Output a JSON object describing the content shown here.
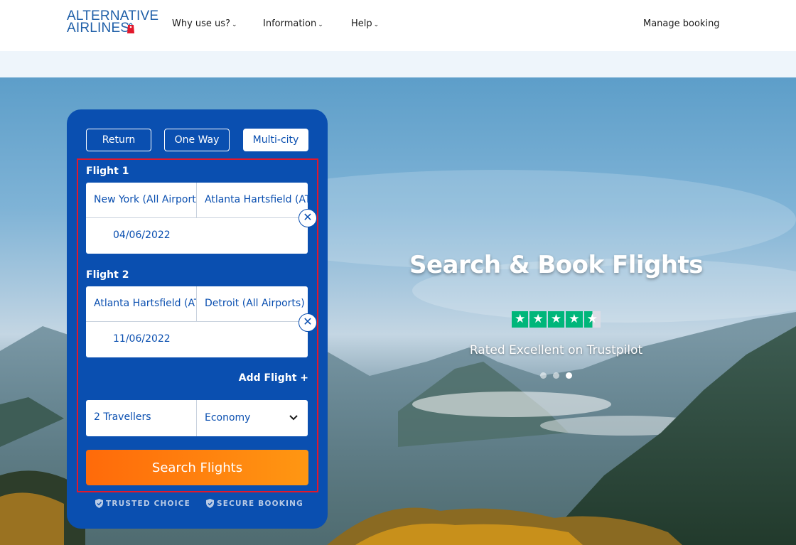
{
  "header": {
    "logo_line1": "ALTERNATIVE",
    "logo_line2": "AIRLINES",
    "nav": [
      {
        "label": "Why use us?"
      },
      {
        "label": "Information"
      },
      {
        "label": "Help"
      }
    ],
    "manage_booking": "Manage booking"
  },
  "hero": {
    "title": "Search & Book Flights",
    "rating_text": "Rated Excellent on Trustpilot",
    "stars": 4.5,
    "carousel_active_index": 2,
    "carousel_count": 3
  },
  "search": {
    "trip_types": [
      {
        "label": "Return",
        "active": false
      },
      {
        "label": "One Way",
        "active": false
      },
      {
        "label": "Multi-city",
        "active": true
      }
    ],
    "flights": [
      {
        "label": "Flight 1",
        "from": "New York (All Airports)",
        "to": "Atlanta Hartsfield (ATL)",
        "date": "04/06/2022"
      },
      {
        "label": "Flight 2",
        "from": "Atlanta Hartsfield (ATL)",
        "to": "Detroit (All Airports)",
        "date": "11/06/2022"
      }
    ],
    "add_flight": "Add Flight +",
    "travellers": "2 Travellers",
    "cabin_class": "Economy",
    "search_button": "Search Flights",
    "badges": [
      "TRUSTED CHOICE",
      "SECURE BOOKING"
    ]
  },
  "colors": {
    "panel": "#0a4fb0",
    "search_button": "#ff7a0c",
    "highlight": "#e2182b",
    "trustpilot": "#00b67a"
  },
  "icons": {
    "remove": "close-icon",
    "dropdown": "chevron-down-icon",
    "badge": "shield-check-icon"
  }
}
